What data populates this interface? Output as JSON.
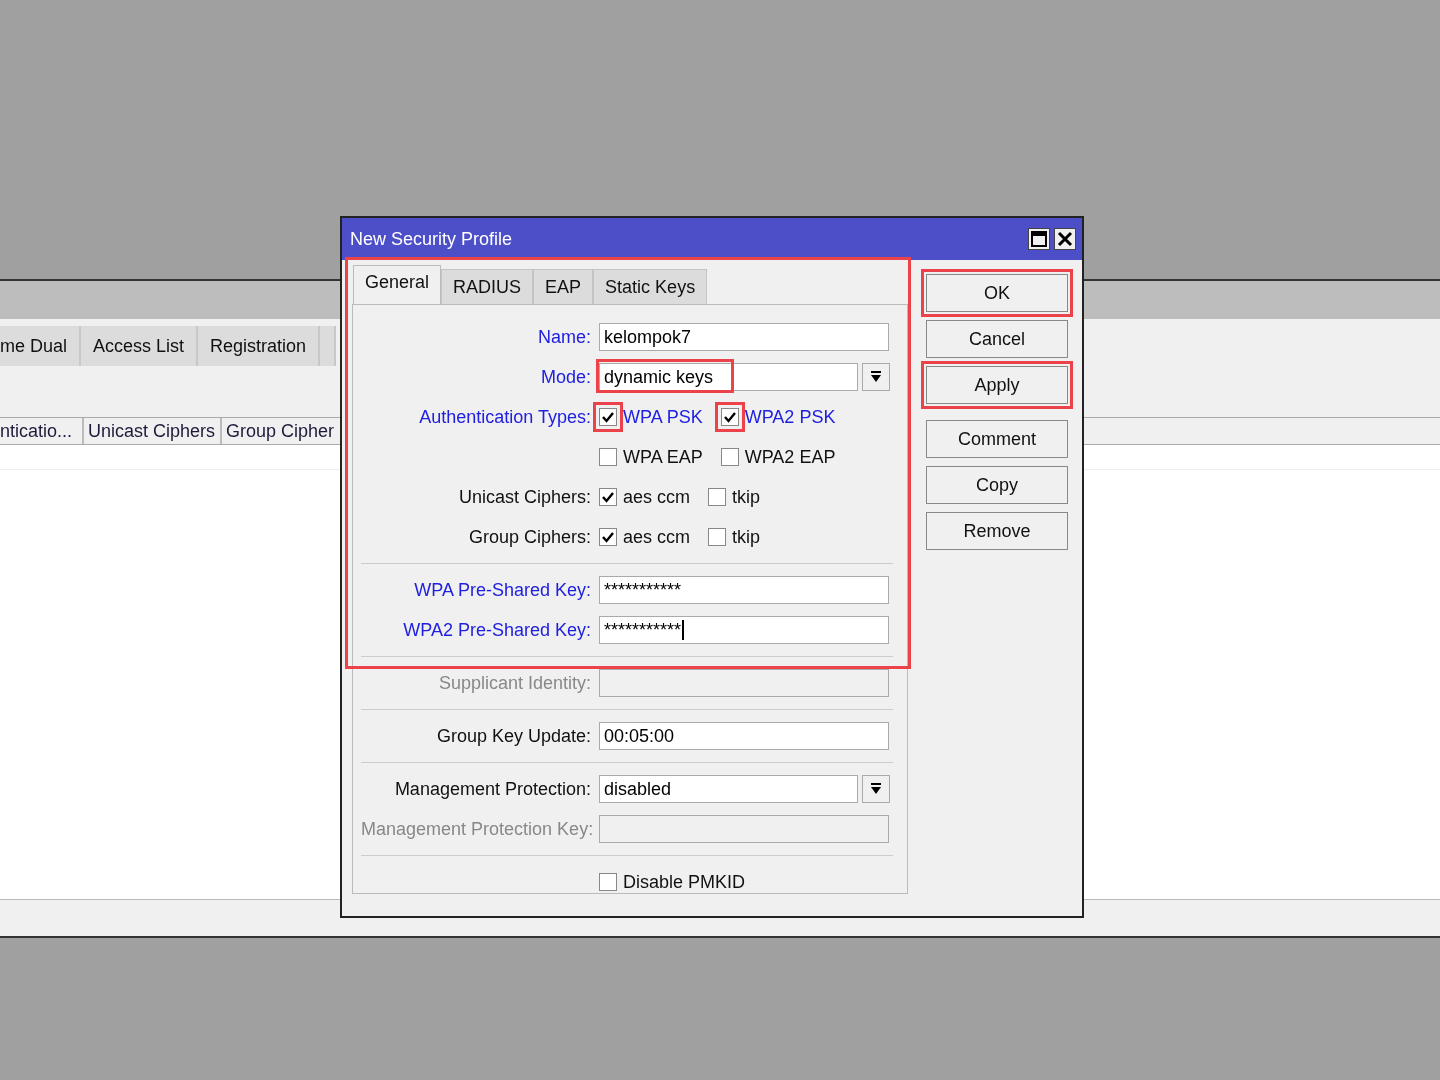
{
  "background_window": {
    "tabs": [
      "me Dual",
      "Access List",
      "Registration"
    ],
    "table": {
      "columns": [
        "nticatio...",
        "Unicast Ciphers",
        "Group Cipher"
      ]
    }
  },
  "dialog": {
    "title": "New Security Profile",
    "highlighted_section": true,
    "tabs": [
      {
        "label": "General",
        "selected": true
      },
      {
        "label": "RADIUS",
        "selected": false
      },
      {
        "label": "EAP",
        "selected": false
      },
      {
        "label": "Static Keys",
        "selected": false
      }
    ],
    "rows": [
      {
        "kind": "text",
        "label": "Name:",
        "emphasized": true,
        "value": "kelompok7"
      },
      {
        "kind": "select",
        "label": "Mode:",
        "emphasized": true,
        "value": "dynamic keys",
        "highlighted": true
      },
      {
        "kind": "checks",
        "label": "Authentication Types:",
        "emphasized": true,
        "options": [
          {
            "label": "WPA PSK",
            "checked": true,
            "emphasized": true,
            "highlighted": true
          },
          {
            "label": "WPA2 PSK",
            "checked": true,
            "emphasized": true,
            "highlighted": true
          }
        ]
      },
      {
        "kind": "checks",
        "options": [
          {
            "label": "WPA EAP",
            "checked": false,
            "emphasized": false,
            "highlighted": false
          },
          {
            "label": "WPA2 EAP",
            "checked": false,
            "emphasized": false,
            "highlighted": false
          }
        ]
      },
      {
        "kind": "checks",
        "label": "Unicast Ciphers:",
        "emphasized": false,
        "options": [
          {
            "label": "aes ccm",
            "checked": true,
            "emphasized": false,
            "highlighted": false
          },
          {
            "label": "tkip",
            "checked": false,
            "emphasized": false,
            "highlighted": false
          }
        ]
      },
      {
        "kind": "checks",
        "label": "Group Ciphers:",
        "emphasized": false,
        "options": [
          {
            "label": "aes ccm",
            "checked": true,
            "emphasized": false,
            "highlighted": false
          },
          {
            "label": "tkip",
            "checked": false,
            "emphasized": false,
            "highlighted": false
          }
        ]
      },
      {
        "kind": "separator"
      },
      {
        "kind": "password",
        "label": "WPA Pre-Shared Key:",
        "emphasized": true,
        "value": "***********"
      },
      {
        "kind": "password",
        "label": "WPA2 Pre-Shared Key:",
        "emphasized": true,
        "value": "***********",
        "cursor": true
      },
      {
        "kind": "separator"
      },
      {
        "kind": "text",
        "label": "Supplicant Identity:",
        "disabled": true
      },
      {
        "kind": "separator"
      },
      {
        "kind": "text",
        "label": "Group Key Update:",
        "emphasized": false,
        "value": "00:05:00"
      },
      {
        "kind": "separator"
      },
      {
        "kind": "select",
        "label": "Management Protection:",
        "emphasized": false,
        "value": "disabled",
        "highlighted": false
      },
      {
        "kind": "text",
        "label": "Management Protection Key:",
        "disabled": true
      },
      {
        "kind": "separator"
      },
      {
        "kind": "checks",
        "options": [
          {
            "label": "Disable PMKID",
            "checked": false,
            "emphasized": false,
            "highlighted": false
          }
        ]
      }
    ],
    "button_groups": [
      [
        {
          "label": "OK",
          "highlighted": true
        },
        {
          "label": "Cancel",
          "highlighted": false
        },
        {
          "label": "Apply",
          "highlighted": true
        }
      ],
      [
        {
          "label": "Comment",
          "highlighted": false
        },
        {
          "label": "Copy",
          "highlighted": false
        },
        {
          "label": "Remove",
          "highlighted": false
        }
      ]
    ]
  }
}
